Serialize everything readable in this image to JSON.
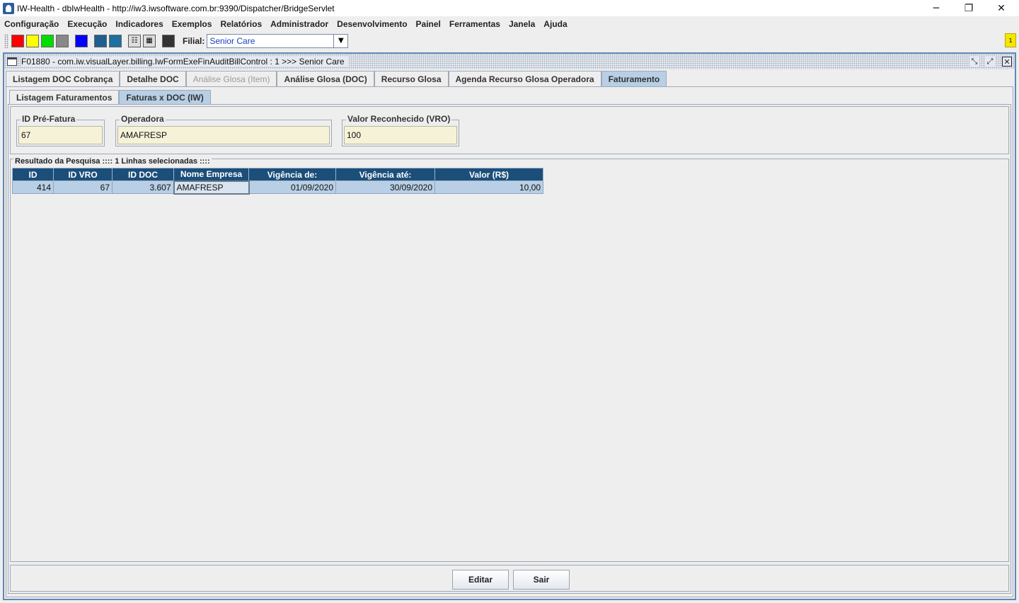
{
  "window": {
    "title": "IW-Health - dbIwHealth - http://iw3.iwsoftware.com.br:9390/Dispatcher/BridgeServlet",
    "minimize_glyph": "─",
    "maximize_glyph": "❐",
    "close_glyph": "✕"
  },
  "menu": {
    "items": [
      "Configuração",
      "Execução",
      "Indicadores",
      "Exemplos",
      "Relatórios",
      "Administrador",
      "Desenvolvimento",
      "Painel",
      "Ferramentas",
      "Janela",
      "Ajuda"
    ]
  },
  "toolbar": {
    "swatches": [
      "#ff0000",
      "#ffff00",
      "#00dd00",
      "#888888",
      "#0000ff",
      "#1f5f8f",
      "#1f6fa0",
      "#333333"
    ],
    "filial_label": "Filial:",
    "filial_value": "Senior Care",
    "notification": "1"
  },
  "frame": {
    "title": "F01880 - com.iw.visualLayer.billing.IwFormExeFinAuditBillControl : 1 >>> Senior Care"
  },
  "main_tabs": [
    {
      "label": "Listagem DOC Cobrança",
      "state": "normal"
    },
    {
      "label": "Detalhe DOC",
      "state": "normal"
    },
    {
      "label": "Análise Glosa (Item)",
      "state": "disabled"
    },
    {
      "label": "Análise Glosa (DOC)",
      "state": "normal"
    },
    {
      "label": "Recurso Glosa",
      "state": "normal"
    },
    {
      "label": "Agenda Recurso Glosa Operadora",
      "state": "normal"
    },
    {
      "label": "Faturamento",
      "state": "active"
    }
  ],
  "sub_tabs": [
    {
      "label": "Listagem Faturamentos",
      "state": "normal"
    },
    {
      "label": "Faturas x DOC (IW)",
      "state": "active"
    }
  ],
  "fields": {
    "id_pre_fatura": {
      "label": "ID Pré-Fatura",
      "value": "67"
    },
    "operadora": {
      "label": "Operadora",
      "value": "AMAFRESP"
    },
    "valor_reconhecido": {
      "label": "Valor Reconhecido (VRO)",
      "value": "100"
    }
  },
  "results": {
    "legend": "Resultado da Pesquisa :::: 1 Linhas selecionadas ::::",
    "columns": [
      "ID",
      "ID VRO",
      "ID DOC",
      "Nome Empresa",
      "Vigência de:",
      "Vigência até:",
      "Valor (R$)"
    ],
    "rows": [
      [
        "414",
        "67",
        "3.607",
        "AMAFRESP",
        "01/09/2020",
        "30/09/2020",
        "10,00"
      ]
    ]
  },
  "buttons": {
    "editar": "Editar",
    "sair": "Sair"
  }
}
